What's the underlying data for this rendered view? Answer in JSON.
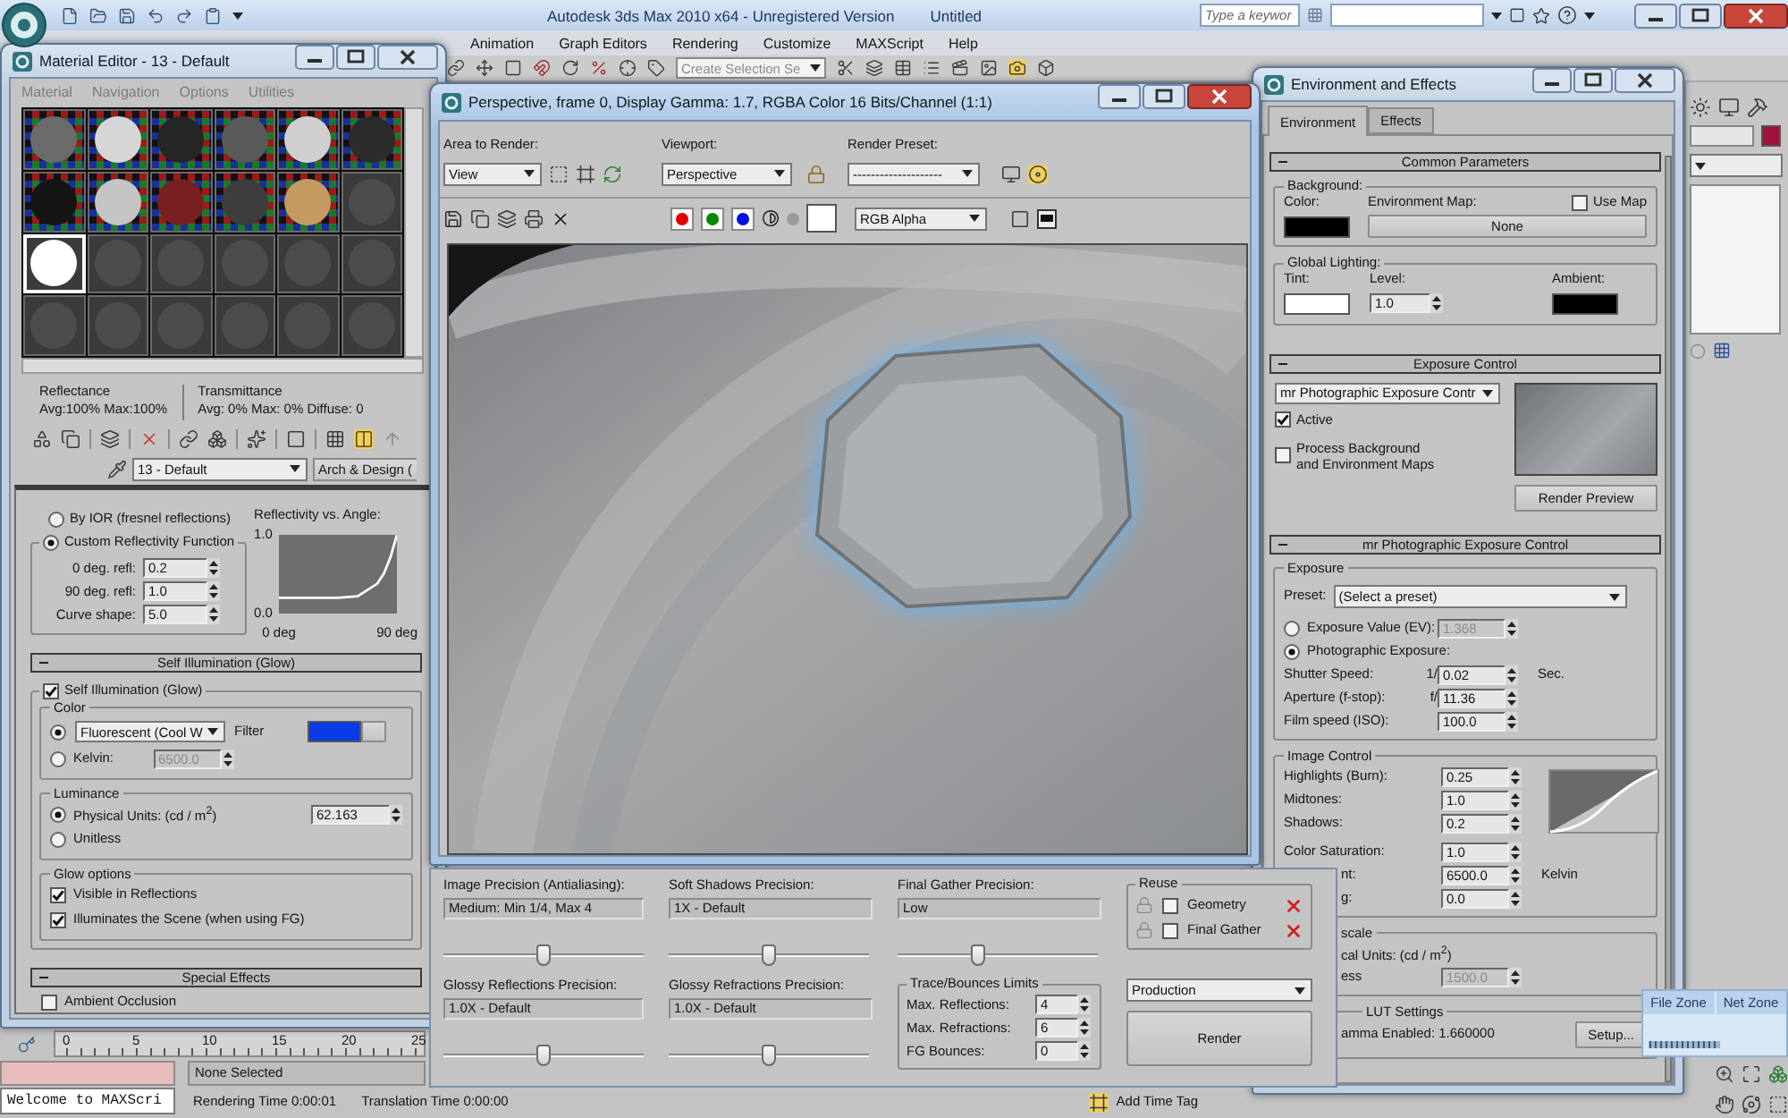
{
  "app": {
    "title": "Autodesk 3ds Max 2010 x64 - Unregistered Version",
    "document": "Untitled",
    "search": {
      "placeholder": "Type a keywor"
    },
    "menu": [
      {
        "label": "Animation"
      },
      {
        "label": "Graph Editors"
      },
      {
        "label": "Rendering"
      },
      {
        "label": "Customize"
      },
      {
        "label": "MAXScript"
      },
      {
        "label": "Help"
      }
    ],
    "selection_set": {
      "placeholder": "Create Selection Se"
    }
  },
  "material_editor": {
    "title": "Material Editor - 13 - Default",
    "menu": [
      {
        "label": "Material"
      },
      {
        "label": "Navigation"
      },
      {
        "label": "Options"
      },
      {
        "label": "Utilities"
      }
    ],
    "slots": [
      {
        "kind": "checker",
        "color": "#6b6b6b",
        "selected": false
      },
      {
        "kind": "checker",
        "color": "#d6d6d6",
        "selected": false
      },
      {
        "kind": "checker",
        "color": "#262626",
        "selected": false
      },
      {
        "kind": "checker",
        "color": "#5a5a5a",
        "selected": false
      },
      {
        "kind": "checker",
        "color": "#cfcfcf",
        "selected": false
      },
      {
        "kind": "checker",
        "color": "#2b2b2b",
        "selected": false
      },
      {
        "kind": "checker",
        "color": "#151515",
        "selected": false
      },
      {
        "kind": "checker",
        "color": "#c4c4c4",
        "selected": false
      },
      {
        "kind": "checker",
        "color": "#7a1f1f",
        "selected": false
      },
      {
        "kind": "checker",
        "color": "#3d3d3d",
        "selected": false
      },
      {
        "kind": "checker",
        "color": "#c49a62",
        "selected": false
      },
      {
        "kind": "plain",
        "color": "#4c4c4c",
        "selected": false
      },
      {
        "kind": "plain",
        "color": "#ffffff",
        "selected": true
      },
      {
        "kind": "plain",
        "color": "#4c4c4c",
        "selected": false
      },
      {
        "kind": "plain",
        "color": "#4c4c4c",
        "selected": false
      },
      {
        "kind": "plain",
        "color": "#4c4c4c",
        "selected": false
      },
      {
        "kind": "plain",
        "color": "#4c4c4c",
        "selected": false
      },
      {
        "kind": "plain",
        "color": "#4c4c4c",
        "selected": false
      },
      {
        "kind": "plain",
        "color": "#4c4c4c",
        "selected": false
      },
      {
        "kind": "plain",
        "color": "#4c4c4c",
        "selected": false
      },
      {
        "kind": "plain",
        "color": "#4c4c4c",
        "selected": false
      },
      {
        "kind": "plain",
        "color": "#4c4c4c",
        "selected": false
      },
      {
        "kind": "plain",
        "color": "#4c4c4c",
        "selected": false
      },
      {
        "kind": "plain",
        "color": "#4c4c4c",
        "selected": false
      }
    ],
    "reflectance": {
      "label": "Reflectance",
      "values": "Avg:100% Max:100%"
    },
    "transmittance": {
      "label": "Transmittance",
      "values": "Avg: 0% Max: 0% Diffuse: 0"
    },
    "material_name": "13 - Default",
    "material_type": "Arch & Design (",
    "brdf": {
      "options": [
        {
          "label": "By IOR (fresnel reflections)",
          "selected": false
        },
        {
          "label": "Custom Reflectivity Function",
          "selected": true
        }
      ],
      "spinners": [
        {
          "label": "0 deg. refl:",
          "value": "0.2"
        },
        {
          "label": "90 deg. refl:",
          "value": "1.0"
        },
        {
          "label": "Curve shape:",
          "value": "5.0"
        }
      ],
      "chart_data": {
        "type": "line",
        "title": "Reflectivity vs. Angle:",
        "x": [
          0,
          15,
          30,
          45,
          60,
          75,
          80,
          85,
          90
        ],
        "series": [
          {
            "color": "#ffffff",
            "values": [
              0.2,
              0.2,
              0.2,
              0.2,
              0.22,
              0.38,
              0.51,
              0.71,
              1.0
            ]
          }
        ],
        "xlim": [
          0,
          90
        ],
        "ylim": [
          0,
          1
        ],
        "xticks": [
          {
            "value": 0,
            "label": "0 deg"
          },
          {
            "value": 90,
            "label": "90 deg"
          }
        ],
        "yticks": [
          {
            "value": 0,
            "label": "0.0"
          },
          {
            "value": 1,
            "label": "1.0"
          }
        ]
      }
    },
    "self_illumination": {
      "header": "Self Illumination (Glow)",
      "toggle": {
        "label": "Self Illumination (Glow)",
        "checked": true
      },
      "color": {
        "title": "Color",
        "options": [
          {
            "kind": "preset",
            "selected": true,
            "value": "Fluorescent (Cool W"
          },
          {
            "kind": "kelvin",
            "label": "Kelvin:",
            "selected": false,
            "value": "6500.0"
          }
        ],
        "filter": {
          "label": "Filter",
          "color": "#0a3be8"
        }
      },
      "luminance": {
        "title": "Luminance",
        "options": [
          {
            "label": "Physical Units: (cd / m$^{2}$)",
            "selected": true,
            "value": "62.163"
          },
          {
            "label": "Unitless",
            "selected": false
          }
        ]
      },
      "glow_options": {
        "title": "Glow options",
        "items": [
          {
            "label": "Visible in Reflections",
            "checked": true
          },
          {
            "label": "Illuminates the Scene (when using FG)",
            "checked": true
          }
        ]
      }
    },
    "special_effects": {
      "header": "Special Effects",
      "items": [
        {
          "label": "Ambient Occlusion",
          "checked": false
        }
      ]
    }
  },
  "render_frame": {
    "title": "Perspective, frame 0, Display Gamma: 1.7, RGBA Color 16 Bits/Channel (1:1)",
    "area_to_render": {
      "label": "Area to Render:",
      "value": "View"
    },
    "viewport": {
      "label": "Viewport:",
      "value": "Perspective"
    },
    "render_preset": {
      "label": "Render Preset:",
      "value": "--------------------"
    },
    "channels": [
      {
        "color": "#e00000",
        "on": true
      },
      {
        "color": "#008a00",
        "on": true
      },
      {
        "color": "#0010e0",
        "on": true
      }
    ],
    "display_channel": "RGB Alpha"
  },
  "render_settings": {
    "precision": [
      {
        "label": "Image Precision (Antialiasing):",
        "value": "Medium: Min 1/4, Max 4",
        "level": 0.5
      },
      {
        "label": "Soft Shadows Precision:",
        "value": "1X - Default",
        "level": 0.5
      },
      {
        "label": "Final Gather Precision:",
        "value": "Low",
        "level": 0.4
      },
      {
        "label": "Glossy Reflections Precision:",
        "value": "1.0X - Default",
        "level": 0.5
      },
      {
        "label": "Glossy Refractions Precision:",
        "value": "1.0X - Default",
        "level": 0.5
      }
    ],
    "trace_limits": {
      "title": "Trace/Bounces Limits",
      "items": [
        {
          "label": "Max. Reflections:",
          "value": "4"
        },
        {
          "label": "Max. Refractions:",
          "value": "6"
        },
        {
          "label": "FG Bounces:",
          "value": "0"
        }
      ]
    },
    "reuse": {
      "title": "Reuse",
      "items": [
        {
          "label": "Geometry",
          "checked": false
        },
        {
          "label": "Final Gather",
          "checked": false
        }
      ]
    },
    "mode": "Production",
    "render_button": "Render"
  },
  "environment": {
    "title": "Environment and Effects",
    "tabs": [
      {
        "label": "Environment",
        "selected": true
      },
      {
        "label": "Effects",
        "selected": false
      }
    ],
    "common": {
      "header": "Common Parameters",
      "background": {
        "title": "Background:",
        "color_label": "Color:",
        "color": "#000000",
        "map_label": "Environment Map:",
        "use_map": {
          "label": "Use Map",
          "checked": false
        },
        "map_button": "None"
      },
      "global_lighting": {
        "title": "Global Lighting:",
        "tint": {
          "label": "Tint:",
          "color": "#ffffff"
        },
        "level": {
          "label": "Level:",
          "value": "1.0"
        },
        "ambient": {
          "label": "Ambient:",
          "color": "#000000"
        }
      }
    },
    "exposure_control": {
      "header": "Exposure Control",
      "type": "mr Photographic Exposure Contr",
      "options": [
        {
          "label": "Active",
          "checked": true
        },
        {
          "label": "Process Background\nand Environment Maps",
          "checked": false
        }
      ],
      "preview_button": "Render Preview"
    },
    "mr_exposure": {
      "header": "mr Photographic Exposure Control",
      "exposure": {
        "title": "Exposure",
        "preset_label": "Preset:",
        "preset": "(Select a preset)",
        "modes": [
          {
            "label": "Exposure Value (EV):",
            "selected": false,
            "value": "1.368"
          },
          {
            "label": "Photographic Exposure:",
            "selected": true
          }
        ],
        "rows": [
          {
            "label": "Shutter Speed:",
            "prefix": "1/",
            "value": "0.02",
            "unit": "Sec."
          },
          {
            "label": "Aperture (f-stop):",
            "prefix": "f/",
            "value": "11.36"
          },
          {
            "label": "Film speed (ISO):",
            "value": "100.0"
          }
        ]
      },
      "image_control": {
        "title": "Image Control",
        "rows": [
          {
            "label": "Highlights (Burn):",
            "value": "0.25"
          },
          {
            "label": "Midtones:",
            "value": "1.0"
          },
          {
            "label": "Shadows:",
            "value": "0.2"
          },
          {
            "label": "Color Saturation:",
            "value": "1.0"
          },
          {
            "label": "nt:",
            "value": "6500.0",
            "unit": "Kelvin"
          },
          {
            "label": "g:",
            "value": "0.0"
          }
        ]
      },
      "physical_scale": {
        "title": "scale",
        "option": "cal Units: (cd / m$^{2}$)",
        "label": "ess",
        "value": "1500.0",
        "disabled": true
      },
      "lut": {
        "title": "LUT Settings",
        "text": "amma Enabled: 1.660000",
        "button": "Setup..."
      }
    }
  },
  "command_panel": {
    "object_color": {
      "color": "#a3123c"
    }
  },
  "timeline": {
    "ticks": [
      "0",
      "5",
      "10",
      "15",
      "20",
      "25"
    ]
  },
  "status_bar": {
    "listener": "Welcome to MAXScri",
    "selection": "None Selected",
    "rendering_time": "Rendering Time 0:00:01",
    "translation_time": "Translation Time 0:00:00",
    "time_tag": "Add Time Tag"
  },
  "zones": [
    {
      "label": "File Zone"
    },
    {
      "label": "Net Zone"
    }
  ]
}
